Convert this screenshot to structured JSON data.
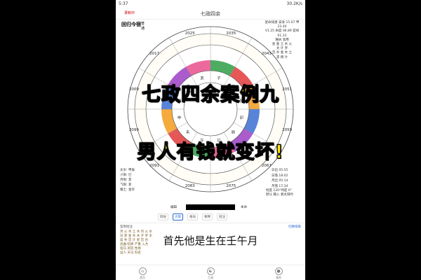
{
  "status": {
    "time": "5:37",
    "battery": "30.2K/s"
  },
  "header": {
    "recording": "录制中",
    "title": "七政四余"
  },
  "chart_left": {
    "title": "回归今宿",
    "option": "普通"
  },
  "wheel": {
    "years": [
      "2035",
      "2043",
      "2051",
      "2059",
      "2067",
      "2075",
      "2083",
      "2091",
      "2099",
      "2009",
      "2017",
      "2025"
    ],
    "branches": [
      "子",
      "丑",
      "寅",
      "卯",
      "辰",
      "巳",
      "午",
      "未",
      "申",
      "酉",
      "戌",
      "亥"
    ],
    "ring_colors": [
      "#2e9e45",
      "#e23b3b",
      "#f39b1c",
      "#3a6fd1",
      "#9b3fc4",
      "#e84f8c"
    ]
  },
  "right_info": [
    "星命排盘 安身 15.07 甲23.40",
    "V1.25 命度 06.89 官禄 01.22",
    "难执 恩用",
    "星 金 土 木 火",
    "太 计 罗",
    "宫 水 金 木 土",
    "李 拜 计"
  ],
  "left_info": [
    "太岁: 甲辰",
    "小限: 巳",
    "月限: 亥",
    "飞限: 亥",
    "耀土: 金孛"
  ],
  "right_info2": [
    "日出 05:55",
    "日落 18:02",
    "月出 05:14",
    "月落 17:34"
  ],
  "bottom_info": [
    "经度 120°纬度 0°",
    "默认 输入 真太阳时"
  ],
  "name_row": {
    "label": "编辑",
    "right": "本命"
  },
  "tabs": [
    "四柱",
    "大限",
    "格局",
    "要释",
    "批注"
  ],
  "table": {
    "title": "案例批注",
    "right": "切换排版",
    "rows": [
      "月 火 木 土 木 月 火 水",
      "日 亥 金 木 木 子 罗 水",
      "庙 失 宫 计 星 宫 合",
      "昌曲 陷降 严重 入亢",
      "墙马 刑克 性格",
      "运人 天马 科名"
    ]
  },
  "tabbar": [
    "首页",
    "工具",
    "我的"
  ],
  "overlay": {
    "line1": "七政四余案例九",
    "line2": "男人有钱就变坏!",
    "subtitle": "首先他是生在壬午月"
  }
}
